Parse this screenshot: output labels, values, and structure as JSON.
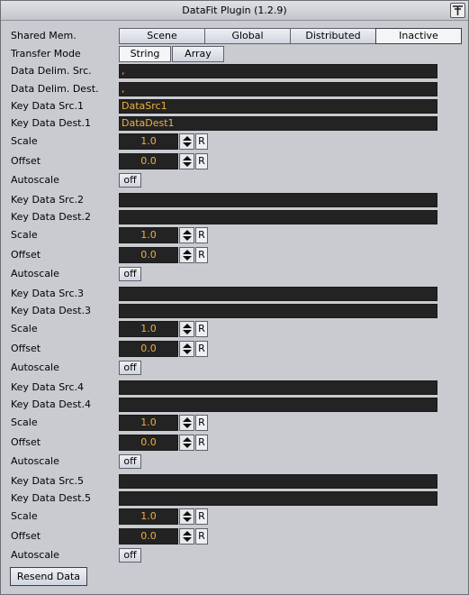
{
  "window": {
    "title": "DataFit Plugin (1.2.9)"
  },
  "shared_mem": {
    "label": "Shared Mem.",
    "options": [
      "Scene",
      "Global",
      "Distributed",
      "Inactive"
    ],
    "selected": "Inactive"
  },
  "transfer_mode": {
    "label": "Transfer Mode",
    "options": [
      "String",
      "Array"
    ],
    "selected": "String"
  },
  "delim_src": {
    "label": "Data Delim. Src.",
    "value": ","
  },
  "delim_dest": {
    "label": "Data Delim. Dest.",
    "value": ","
  },
  "blocks": [
    {
      "src_label": "Key Data Src.1",
      "src_value": "DataSrc1",
      "dest_label": "Key Data Dest.1",
      "dest_value": "DataDest1",
      "scale_label": "Scale",
      "scale": "1.0",
      "offset_label": "Offset",
      "offset": "0.0",
      "autoscale_label": "Autoscale",
      "autoscale": "off"
    },
    {
      "src_label": "Key Data Src.2",
      "src_value": "",
      "dest_label": "Key Data Dest.2",
      "dest_value": "",
      "scale_label": "Scale",
      "scale": "1.0",
      "offset_label": "Offset",
      "offset": "0.0",
      "autoscale_label": "Autoscale",
      "autoscale": "off"
    },
    {
      "src_label": "Key Data Src.3",
      "src_value": "",
      "dest_label": "Key Data Dest.3",
      "dest_value": "",
      "scale_label": "Scale",
      "scale": "1.0",
      "offset_label": "Offset",
      "offset": "0.0",
      "autoscale_label": "Autoscale",
      "autoscale": "off"
    },
    {
      "src_label": "Key Data Src.4",
      "src_value": "",
      "dest_label": "Key Data Dest.4",
      "dest_value": "",
      "scale_label": "Scale",
      "scale": "1.0",
      "offset_label": "Offset",
      "offset": "0.0",
      "autoscale_label": "Autoscale",
      "autoscale": "off"
    },
    {
      "src_label": "Key Data Src.5",
      "src_value": "",
      "dest_label": "Key Data Dest.5",
      "dest_value": "",
      "scale_label": "Scale",
      "scale": "1.0",
      "offset_label": "Offset",
      "offset": "0.0",
      "autoscale_label": "Autoscale",
      "autoscale": "off"
    }
  ],
  "reset_label": "R",
  "resend_label": "Resend Data",
  "icons": {
    "title": "plugin-logo-icon",
    "spin": "spinner-arrows-icon"
  },
  "colors": {
    "field_bg": "#232323",
    "field_text": "#f0b040",
    "panel_bg": "#c9cbd0"
  }
}
